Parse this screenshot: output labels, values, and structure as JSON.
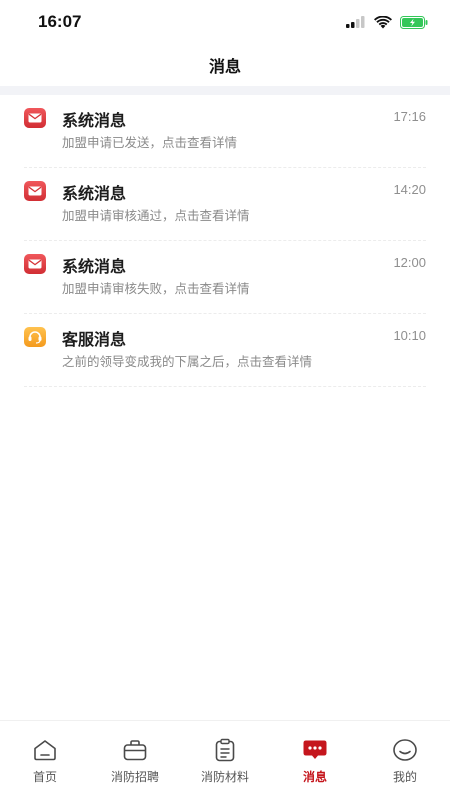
{
  "status_bar": {
    "time": "16:07"
  },
  "header": {
    "title": "消息"
  },
  "messages": [
    {
      "title": "系统消息",
      "desc": "加盟申请已发送，点击查看详情",
      "time": "17:16",
      "icon": "mail-icon"
    },
    {
      "title": "系统消息",
      "desc": "加盟申请审核通过，点击查看详情",
      "time": "14:20",
      "icon": "mail-icon"
    },
    {
      "title": "系统消息",
      "desc": "加盟申请审核失败，点击查看详情",
      "time": "12:00",
      "icon": "mail-icon"
    },
    {
      "title": "客服消息",
      "desc": "之前的领导变成我的下属之后，点击查看详情",
      "time": "10:10",
      "icon": "customer-service-icon"
    }
  ],
  "tabs": [
    {
      "label": "首页",
      "icon": "home-icon",
      "active": false
    },
    {
      "label": "消防招聘",
      "icon": "briefcase-icon",
      "active": false
    },
    {
      "label": "消防材料",
      "icon": "clipboard-icon",
      "active": false
    },
    {
      "label": "消息",
      "icon": "chat-icon",
      "active": true
    },
    {
      "label": "我的",
      "icon": "smiley-icon",
      "active": false
    }
  ],
  "colors": {
    "accent": "#c5161d",
    "mail_icon": "#e03a3f",
    "service_icon": "#f6a623",
    "battery": "#34c759"
  }
}
